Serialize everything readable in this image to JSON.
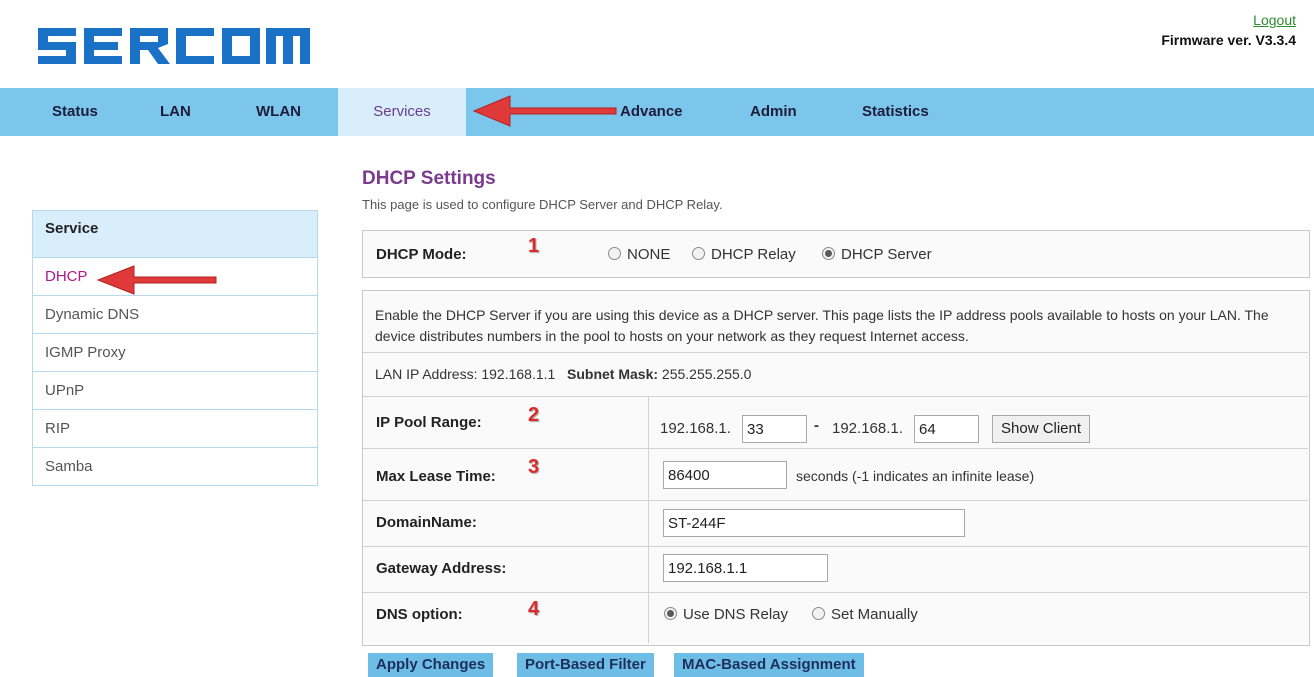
{
  "brand": {
    "logo_text": "SERCOMM",
    "logout": "Logout",
    "firmware": "Firmware ver. V3.3.4"
  },
  "nav": {
    "items": [
      {
        "label": "Status"
      },
      {
        "label": "LAN"
      },
      {
        "label": "WLAN"
      },
      {
        "label": "Services"
      },
      {
        "label": "Advance"
      },
      {
        "label": "Admin"
      },
      {
        "label": "Statistics"
      }
    ],
    "active": "Services"
  },
  "sidebar": {
    "header": "Service",
    "items": [
      {
        "label": "DHCP"
      },
      {
        "label": "Dynamic DNS"
      },
      {
        "label": "IGMP Proxy"
      },
      {
        "label": "UPnP"
      },
      {
        "label": "RIP"
      },
      {
        "label": "Samba"
      }
    ],
    "active": "DHCP"
  },
  "page": {
    "title": "DHCP Settings",
    "subtitle": "This page is used to configure DHCP Server and DHCP Relay."
  },
  "mode": {
    "label": "DHCP Mode:",
    "options": [
      "NONE",
      "DHCP Relay",
      "DHCP Server"
    ],
    "selected": "DHCP Server"
  },
  "server": {
    "description": "Enable the DHCP Server if you are using this device as a DHCP server. This page lists the IP address pools available to hosts on your LAN. The device distributes numbers in the pool to hosts on your network as they request Internet access.",
    "lan_ip_label": "LAN IP Address:",
    "lan_ip": "192.168.1.1",
    "subnet_label": "Subnet Mask:",
    "subnet": "255.255.255.0",
    "pool_label": "IP Pool Range:",
    "pool_prefix": "192.168.1.",
    "pool_start": "33",
    "pool_dash": "-",
    "pool_end": "64",
    "show_client": "Show Client",
    "lease_label": "Max Lease Time:",
    "lease_value": "86400",
    "lease_hint": "seconds (-1 indicates an infinite lease)",
    "domain_label": "DomainName:",
    "domain_value": "ST-244F",
    "gateway_label": "Gateway Address:",
    "gateway_value": "192.168.1.1",
    "dns_label": "DNS option:",
    "dns_options": [
      "Use DNS Relay",
      "Set Manually"
    ],
    "dns_selected": "Use DNS Relay"
  },
  "actions": {
    "apply": "Apply Changes",
    "port_filter": "Port-Based Filter",
    "mac_assign": "MAC-Based Assignment"
  },
  "annotations": [
    "1",
    "2",
    "3",
    "4"
  ],
  "colors": {
    "nav_bg": "#7cc6ec",
    "arrow": "#e0393a",
    "title": "#7a3a8f",
    "active_side": "#b0188c"
  }
}
